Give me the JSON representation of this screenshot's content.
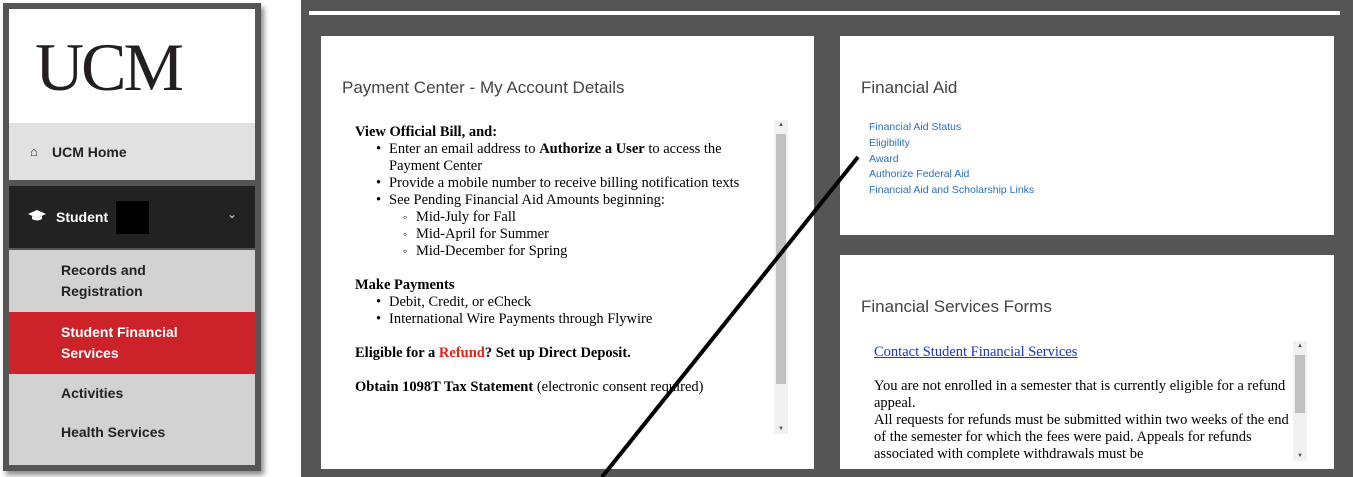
{
  "sidebar": {
    "logo": "UCM",
    "home": {
      "label": "UCM Home",
      "icon": "home-icon"
    },
    "student": {
      "label": "Student",
      "icon": "graduation-cap-icon",
      "chevron": "chevron-down-icon"
    },
    "sub_items": [
      {
        "label_line1": "Records and",
        "label_line2": "Registration"
      },
      {
        "label_line1": "Student Financial",
        "label_line2": "Services"
      },
      {
        "label_line1": "Activities",
        "label_line2": ""
      },
      {
        "label_line1": "Health Services",
        "label_line2": ""
      }
    ]
  },
  "payment_panel": {
    "title": "Payment Center - My Account Details",
    "view_bill": "View Official Bill, and:",
    "b1_pre": "Enter an email address to ",
    "b1_bold": "Authorize a User",
    "b1_post": " to access the Payment Center",
    "b2": "Provide a mobile number to receive billing notification texts",
    "b3": "See Pending Financial Aid Amounts beginning:",
    "s1": "Mid-July for Fall",
    "s2": "Mid-April for Summer",
    "s3": "Mid-December for Spring",
    "make_payments": "Make Payments",
    "p1": "Debit, Credit, or eCheck",
    "p2": "International Wire Payments through Flywire",
    "refund_pre": "Eligible for a ",
    "refund_word": "Refund",
    "refund_post": "? Set up Direct Deposit.",
    "tax_bold": "Obtain 1098T Tax Statement",
    "tax_note": " (electronic consent required)"
  },
  "aid_panel": {
    "title": "Financial Aid",
    "links": [
      "Financial Aid Status",
      "Eligibility",
      "Award",
      "Authorize Federal Aid",
      "Financial Aid and Scholarship Links"
    ]
  },
  "forms_panel": {
    "title": "Financial Services Forms",
    "contact_link": "Contact Student Financial Services",
    "para1": "You are not enrolled in a semester that is currently eligible for a refund appeal.",
    "para2": "All requests for refunds must be submitted within two weeks of the end of the semester for which the fees were paid. Appeals for refunds associated with complete withdrawals must be"
  },
  "colors": {
    "accent_red": "#cc2229",
    "link_blue": "#2a6ebd",
    "frame_gray": "#555555"
  }
}
